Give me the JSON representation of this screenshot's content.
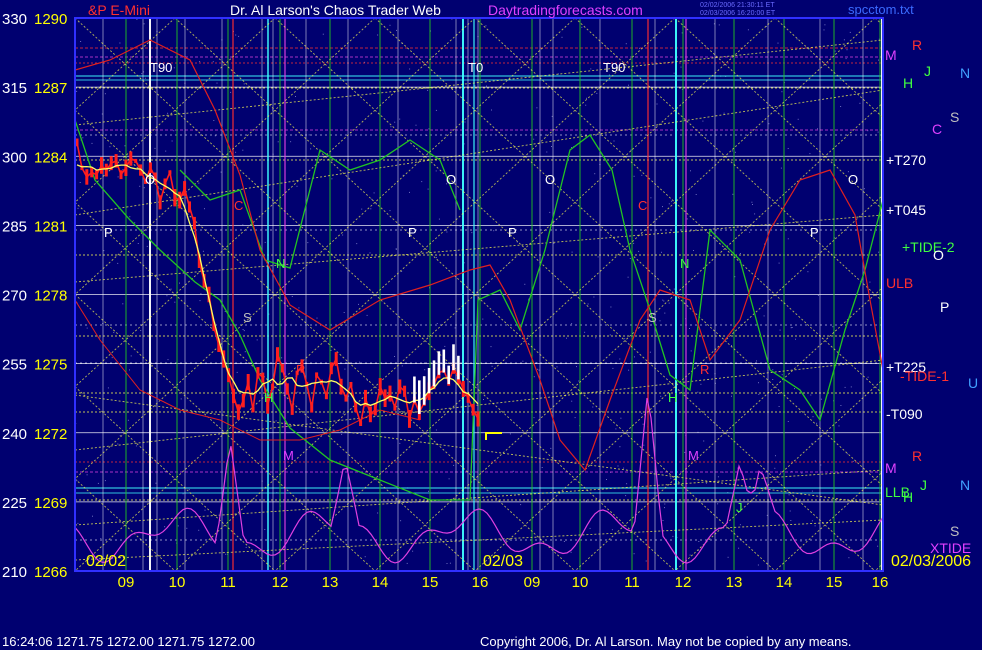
{
  "chart_data": {
    "type": "line",
    "title": "Dr. Al Larson's Chaos Trader Web",
    "symbol": "&P E-Mini",
    "website": "Daytradingforecasts.com",
    "stamp": [
      "02/02/2006 21:30:11 ET",
      "02/03/2006 16:20:00 ET"
    ],
    "file": "spcctom.txt",
    "y_axis_left": {
      "degrees": [
        "330",
        "315",
        "300",
        "285",
        "270",
        "255",
        "240",
        "225",
        "210"
      ],
      "prices": [
        "1290",
        "1287",
        "1284",
        "1281",
        "1278",
        "1275",
        "1272",
        "1269",
        "1266"
      ]
    },
    "ylim": [
      1266,
      1290
    ],
    "x_axis": {
      "hours": [
        "09",
        "10",
        "11",
        "12",
        "13",
        "14",
        "15",
        "16",
        "09",
        "10",
        "11",
        "12",
        "13",
        "14",
        "15",
        "16"
      ],
      "dates": [
        "02/02",
        "02/03",
        "02/03/2006"
      ]
    },
    "time_markers": [
      "T90",
      "T0",
      "T90"
    ],
    "planet_markers_right": [
      "M",
      "H",
      "M",
      "H"
    ],
    "right_labels": [
      "M",
      "R",
      "H",
      "J",
      "N",
      "S",
      "C",
      "+T270",
      "+T045",
      "+TIDE-2",
      "O",
      "ULB",
      "P",
      "+T225",
      "-TIDE-1",
      "U",
      "-T090",
      "M",
      "R",
      "LLB",
      "J",
      "N",
      "H",
      "S",
      "XTIDE"
    ],
    "chart_letters": [
      "O",
      "O",
      "O",
      "O",
      "P",
      "P",
      "P",
      "P",
      "N",
      "N",
      "S",
      "S",
      "C",
      "C",
      "M",
      "M",
      "R",
      "R",
      "H",
      "H",
      "J"
    ],
    "series": [
      {
        "name": "S&P E-Mini",
        "values": [
          1284.6,
          1283.5,
          1283.1,
          1283.3,
          1283.2,
          1283.6,
          1283.4,
          1283.7,
          1283.8,
          1283.2,
          1283.5,
          1283.9,
          1283.8,
          1283.4,
          1282.9,
          1283.5,
          1283.1,
          1282.0,
          1282.8,
          1283.3,
          1282.2,
          1282.1,
          1282.6,
          1281.8,
          1281.1,
          1279.4,
          1278.6,
          1278.0,
          1276.6,
          1275.8,
          1275.2,
          1274.5,
          1273.6,
          1272.9,
          1273.4,
          1274.2,
          1273.0,
          1274.6,
          1274.4,
          1273.2,
          1274.0,
          1275.4,
          1274.8,
          1273.9,
          1273.0,
          1274.6,
          1274.9,
          1274.1,
          1273.1,
          1274.5,
          1274.2,
          1273.6,
          1274.8,
          1275.2,
          1274.0,
          1273.5,
          1274.1,
          1273.1,
          1272.4,
          1273.5,
          1272.8,
          1273.0,
          1274.0,
          1273.5,
          1273.7,
          1273.1,
          1274.0,
          1273.8,
          1272.6,
          1273.4,
          1272.9,
          1273.3,
          1273.8,
          1274.1,
          1274.6,
          1274.7,
          1274.2,
          1274.8,
          1274.4,
          1273.9,
          1273.5,
          1273.0,
          1272.6
        ]
      }
    ]
  },
  "footer": {
    "quote": "16:24:06  1271.75  1272.00  1271.75  1272.00",
    "copyright": "Copyright 2006, Dr. Al Larson.  May not be copied by any means."
  },
  "colors": {
    "background": "#000070",
    "price": "#ff1e1e",
    "price_avg": "#ffff60",
    "current_day": "#ffffff",
    "green_curve": "#22c422",
    "red_curve": "#e02020",
    "magenta_curve": "#e040e0",
    "yellow_grid": "#ffff50",
    "time_label": "#ffffff",
    "axis_text": "#ffff00",
    "title_magenta": "#e040ff"
  }
}
